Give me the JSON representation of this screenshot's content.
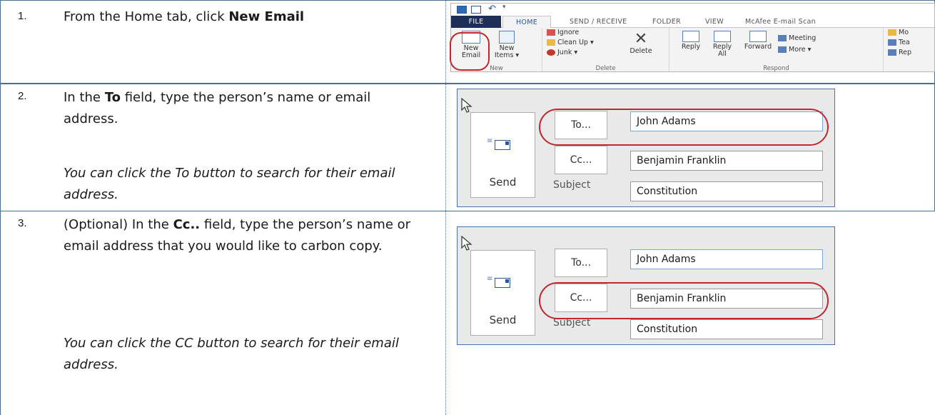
{
  "steps": [
    {
      "number": "1.",
      "text_before": "From the Home tab, click ",
      "text_bold": "New Email",
      "text_after": "",
      "note": ""
    },
    {
      "number": "2.",
      "text_before": "In the ",
      "text_bold": "To",
      "text_after": " field, type the person’s name or email address.",
      "note": "You can click the To button to search for their email address."
    },
    {
      "number": "3.",
      "text_before": "(Optional) In the ",
      "text_bold": "Cc..",
      "text_after": " field, type the person’s name or email address that you would like to carbon copy.",
      "note": "You can click the CC button to search for their email address."
    }
  ],
  "ribbon": {
    "tabs": [
      "FILE",
      "HOME",
      "SEND / RECEIVE",
      "FOLDER",
      "VIEW",
      "McAfee E-mail Scan"
    ],
    "new_group": {
      "new_email_line1": "New",
      "new_email_line2": "Email",
      "new_items_line1": "New",
      "new_items_line2": "Items ▾",
      "label": "New"
    },
    "delete_group": {
      "ignore": "Ignore",
      "clean_up": "Clean Up ▾",
      "junk": "Junk ▾",
      "delete": "Delete",
      "label": "Delete"
    },
    "respond_group": {
      "reply": "Reply",
      "reply_all_line1": "Reply",
      "reply_all_line2": "All",
      "forward": "Forward",
      "meeting": "Meeting",
      "more": "More ▾",
      "label": "Respond"
    },
    "move_group": {
      "item1": "Mo",
      "item2": "Tea",
      "item3": "Rep"
    }
  },
  "compose": {
    "send_label": "Send",
    "to_button": "To...",
    "cc_button": "Cc...",
    "subject_label": "Subject",
    "to_value": "John Adams",
    "cc_value": "Benjamin Franklin",
    "subject_value": "Constitution"
  },
  "colors": {
    "table_border": "#4a6f9a",
    "highlight_oval": "#c0282d",
    "file_tab": "#1e2f57",
    "accent": "#2b579a"
  }
}
